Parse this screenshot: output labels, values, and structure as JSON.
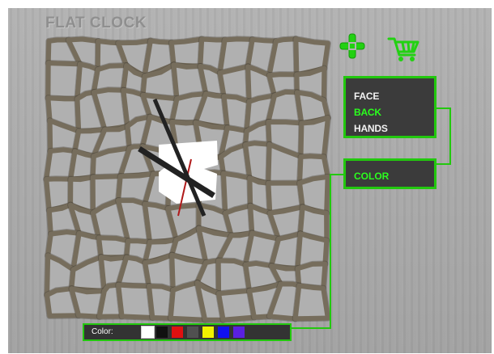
{
  "app": {
    "title": "FLAT CLOCK"
  },
  "clock": {
    "face_color": "#766d5c",
    "face_edge_color": "#3e3a30",
    "center_color": "#ffffff",
    "hands_color": "#222222",
    "second_hand_color": "#b01a1a"
  },
  "toolbar": {
    "add_icon": "plus-cross-icon",
    "cart_icon": "shopping-cart-icon",
    "accent_color": "#2bff1e"
  },
  "menu": {
    "items": [
      {
        "label": "FACE",
        "active": false
      },
      {
        "label": "BACK",
        "active": true
      },
      {
        "label": "HANDS",
        "active": false
      }
    ]
  },
  "color_button": {
    "label": "COLOR"
  },
  "color_bar": {
    "label": "Color:",
    "swatches": [
      "#ffffff",
      "#111111",
      "#e01010",
      "#505050",
      "#f2f200",
      "#1010f0",
      "#5a20e0"
    ]
  }
}
